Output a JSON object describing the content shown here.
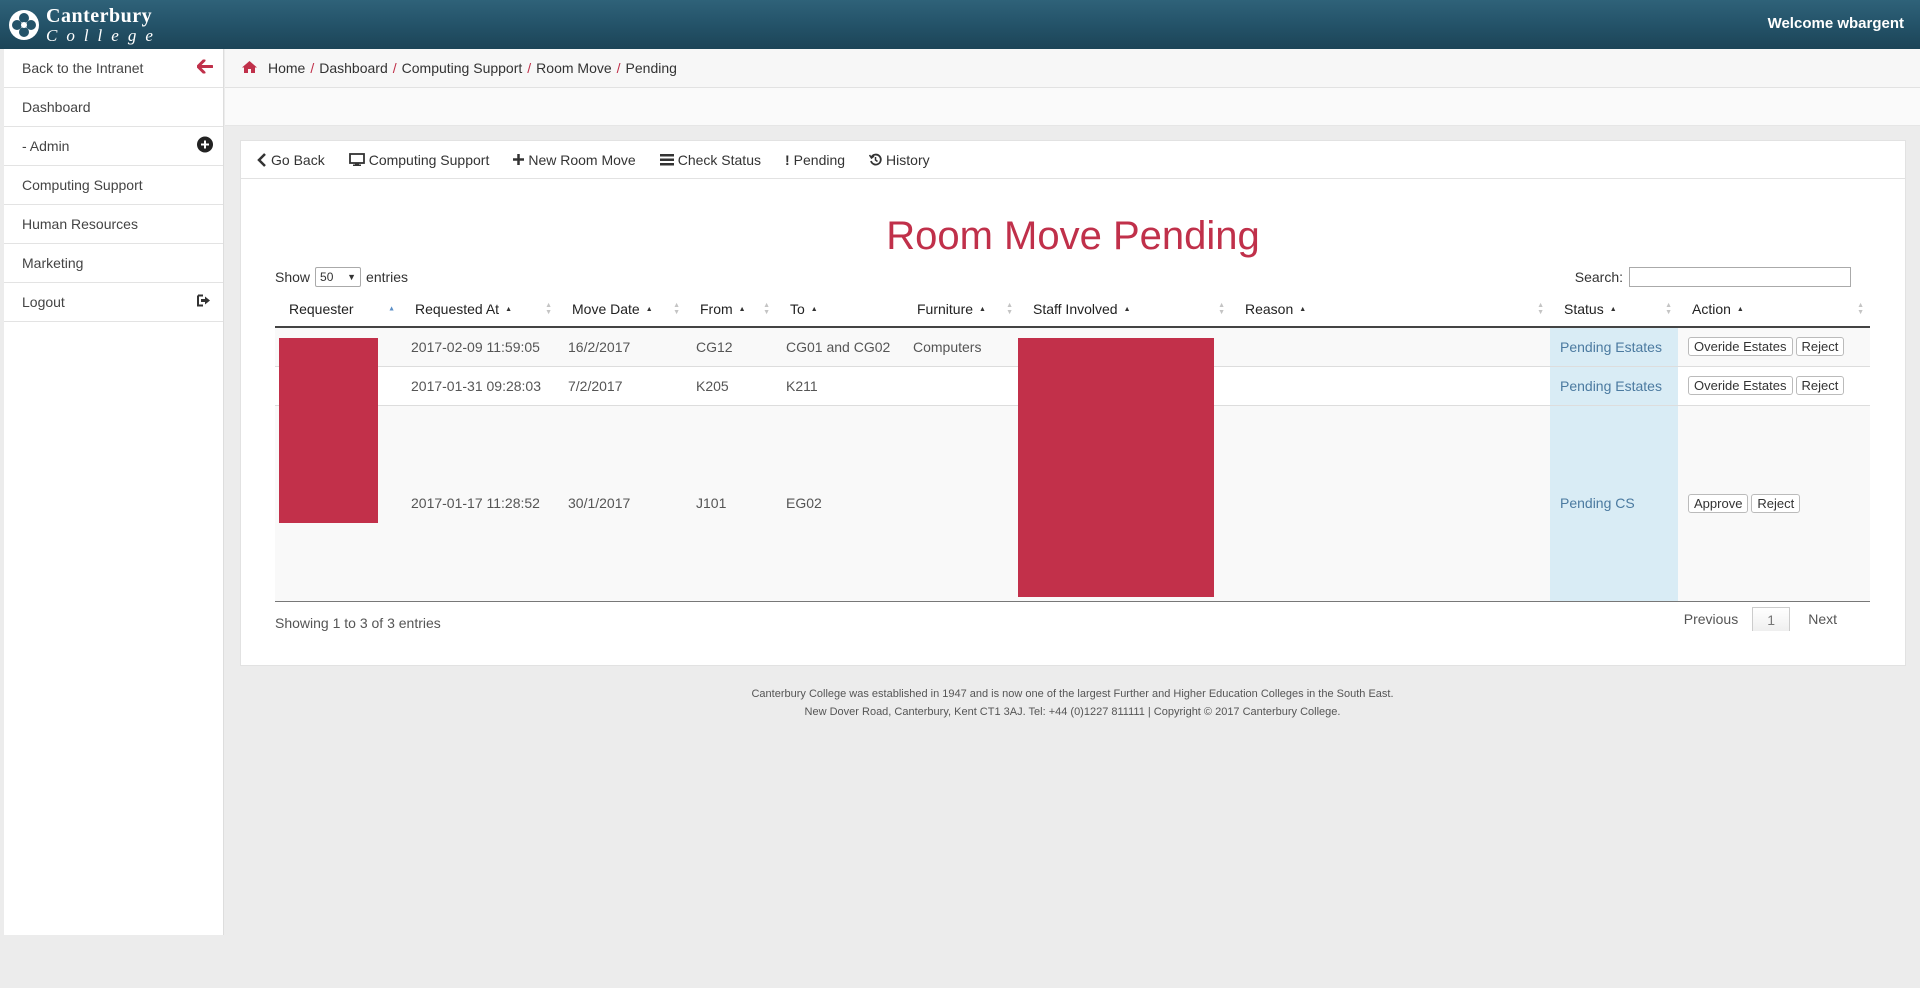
{
  "header": {
    "logo_line1": "Canterbury",
    "logo_line2": "College",
    "welcome": "Welcome wbargent"
  },
  "sidebar": {
    "items": [
      {
        "label": "Back to the Intranet",
        "icon": "arrow-left-icon"
      },
      {
        "label": "Dashboard"
      },
      {
        "label": "- Admin",
        "icon": "plus-circle-icon"
      },
      {
        "label": "Computing Support"
      },
      {
        "label": "Human Resources"
      },
      {
        "label": "Marketing"
      },
      {
        "label": "Logout",
        "icon": "logout-icon"
      }
    ]
  },
  "breadcrumb": {
    "items": [
      "Home",
      "Dashboard",
      "Computing Support",
      "Room Move",
      "Pending"
    ],
    "separator": "/"
  },
  "panel_nav": {
    "go_back": "Go Back",
    "computing_support": "Computing Support",
    "new_room_move": "New Room Move",
    "check_status": "Check Status",
    "pending": "Pending",
    "history": "History"
  },
  "page_title": "Room Move Pending",
  "table_controls": {
    "show_label": "Show",
    "entries_value": "50",
    "entries_label": "entries",
    "search_label": "Search:",
    "search_value": ""
  },
  "table": {
    "columns": [
      "Requester",
      "Requested At",
      "Move Date",
      "From",
      "To",
      "Furniture",
      "Staff Involved",
      "Reason",
      "Status",
      "Action"
    ],
    "rows": [
      {
        "requested_at": "2017-02-09 11:59:05",
        "move_date": "16/2/2017",
        "from": "CG12",
        "to": "CG01 and CG02",
        "furniture": "Computers",
        "reason": "",
        "status": "Pending Estates",
        "actions": [
          "Overide Estates",
          "Reject"
        ]
      },
      {
        "requested_at": "2017-01-31 09:28:03",
        "move_date": "7/2/2017",
        "from": "K205",
        "to": "K211",
        "furniture": "",
        "reason": "",
        "status": "Pending Estates",
        "actions": [
          "Overide Estates",
          "Reject"
        ]
      },
      {
        "requested_at": "2017-01-17 11:28:52",
        "move_date": "30/1/2017",
        "from": "J101",
        "to": "EG02",
        "furniture": "",
        "reason": "",
        "status": "Pending CS",
        "actions": [
          "Approve",
          "Reject"
        ]
      }
    ]
  },
  "table_info": "Showing 1 to 3 of 3 entries",
  "pagination": {
    "previous": "Previous",
    "page": "1",
    "next": "Next"
  },
  "footer": {
    "line1": "Canterbury College was established in 1947 and is now one of the largest Further and Higher Education Colleges in the South East.",
    "line2": "New Dover Road, Canterbury, Kent CT1 3AJ. Tel: +44 (0)1227 811111 | Copyright © 2017 Canterbury College."
  },
  "colors": {
    "topbar": "#245369",
    "accent": "#c0304a",
    "redaction": "#c2304a",
    "status_bg": "#d9ecf5"
  }
}
